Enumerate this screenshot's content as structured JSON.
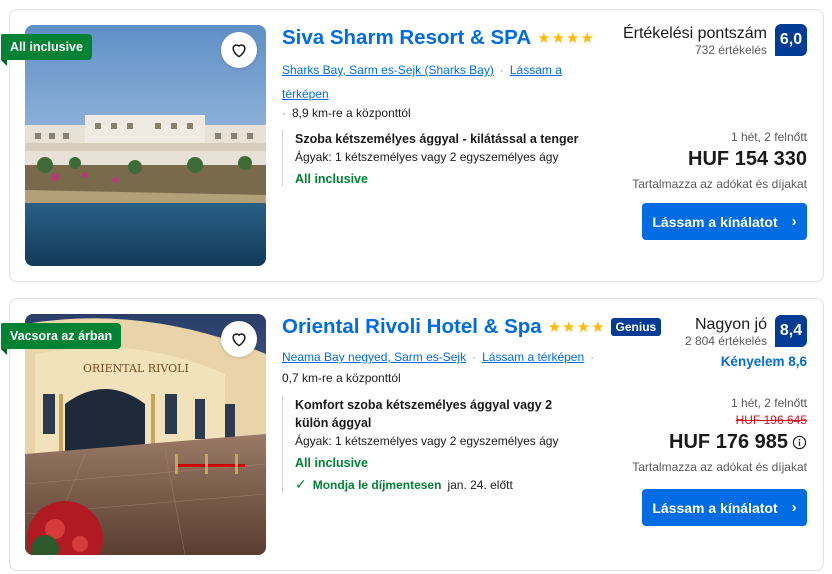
{
  "cards": [
    {
      "ribbon": "All inclusive",
      "name": "Siva Sharm Resort & SPA",
      "stars": 4,
      "genius": "",
      "location": "Sharks Bay, Sarm es-Sejk (Sharks Bay)",
      "map_link": "Lássam a térképen",
      "distance": "8,9 km-re a központtól",
      "room_name": "Szoba kétszemélyes ággyal - kilátással a tenger",
      "beds": "Ágyak: 1 kétszemélyes vagy 2 egyszemélyes ágy",
      "meal": "All inclusive",
      "cancel_label": "",
      "cancel_date": "",
      "review_word": "Értékelési pontszám",
      "review_count": "732 értékelés",
      "score": "6,0",
      "comfort": "",
      "stay": "1 hét, 2 felnőtt",
      "old_price": "",
      "price": "HUF 154 330",
      "tax": "Tartalmazza az adókat és díjakat",
      "cta": "Lássam a kínálatot"
    },
    {
      "ribbon": "Vacsora az árban",
      "name": "Oriental Rivoli Hotel & Spa",
      "stars": 4,
      "genius": "Genius",
      "location": "Neama Bay negyed, Sarm es-Sejk",
      "map_link": "Lássam a térképen",
      "distance": "0,7 km-re a központtól",
      "room_name": "Komfort szoba kétszemélyes ággyal vagy 2 külön ággyal",
      "beds": "Ágyak: 1 kétszemélyes vagy 2 egyszemélyes ágy",
      "meal": "All inclusive",
      "cancel_label": "Mondja le díjmentesen",
      "cancel_date": "jan. 24. előtt",
      "review_word": "Nagyon jó",
      "review_count": "2 804 értékelés",
      "score": "8,4",
      "comfort": "Kényelem 8,6",
      "stay": "1 hét, 2 felnőtt",
      "old_price": "HUF 196 645",
      "price": "HUF 176 985",
      "tax": "Tartalmazza az adókat és díjakat",
      "cta": "Lássam a kínálatot"
    }
  ],
  "icons": {
    "favorite": "heart-icon",
    "info": "info-icon",
    "check": "check-icon",
    "chevron": "chevron-right-icon"
  },
  "colors": {
    "link": "#006ce4",
    "score_bg": "#003b95",
    "ribbon": "#008234",
    "star": "#febb02",
    "old_price": "#d4111e"
  }
}
